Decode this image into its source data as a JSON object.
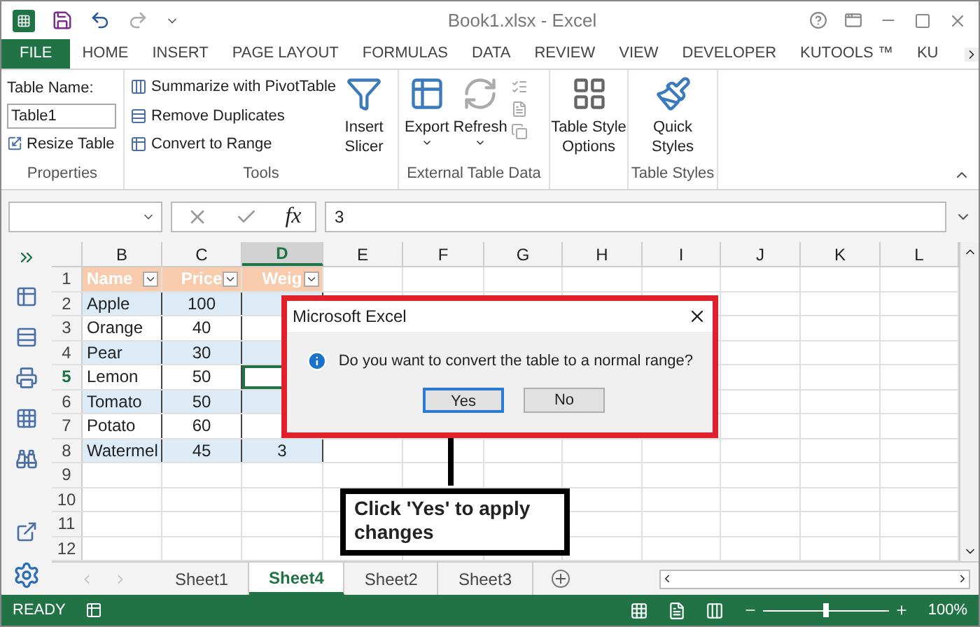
{
  "window": {
    "title": "Book1.xlsx - Excel"
  },
  "tabs": [
    {
      "label": "FILE",
      "kind": "file"
    },
    {
      "label": "HOME",
      "kind": "tab"
    },
    {
      "label": "INSERT",
      "kind": "tab"
    },
    {
      "label": "PAGE LAYOUT",
      "kind": "tab"
    },
    {
      "label": "FORMULAS",
      "kind": "tab"
    },
    {
      "label": "DATA",
      "kind": "tab"
    },
    {
      "label": "REVIEW",
      "kind": "tab"
    },
    {
      "label": "VIEW",
      "kind": "tab"
    },
    {
      "label": "DEVELOPER",
      "kind": "tab"
    },
    {
      "label": "KUTOOLS ™",
      "kind": "tab"
    },
    {
      "label": "KU",
      "kind": "tab"
    }
  ],
  "ribbon": {
    "properties": {
      "table_name_label": "Table Name:",
      "table_name_value": "Table1",
      "resize": "Resize Table",
      "group": "Properties"
    },
    "tools": {
      "items": [
        "Summarize with PivotTable",
        "Remove Duplicates",
        "Convert to Range"
      ],
      "slicer": [
        "Insert",
        "Slicer"
      ],
      "group": "Tools"
    },
    "external": {
      "export": "Export",
      "refresh": "Refresh",
      "group": "External Table Data"
    },
    "style_options": [
      "Table Style",
      "Options"
    ],
    "quick_styles": [
      "Quick",
      "Styles"
    ],
    "table_styles_group": "Table Styles"
  },
  "formula_bar": {
    "fx_label": "fx",
    "value": "3"
  },
  "grid": {
    "columns": [
      {
        "label": "B",
        "selected": false
      },
      {
        "label": "C",
        "selected": false
      },
      {
        "label": "D",
        "selected": true
      },
      {
        "label": "E",
        "selected": false
      },
      {
        "label": "F",
        "selected": false
      },
      {
        "label": "G",
        "selected": false
      },
      {
        "label": "H",
        "selected": false
      },
      {
        "label": "I",
        "selected": false
      },
      {
        "label": "J",
        "selected": false
      },
      {
        "label": "K",
        "selected": false
      },
      {
        "label": "L",
        "selected": false
      }
    ],
    "rows": [
      {
        "label": "1",
        "selected": false,
        "kind": "header",
        "cells": [
          "Name",
          "Price",
          "Weig"
        ]
      },
      {
        "label": "2",
        "selected": false,
        "kind": "data",
        "cells": [
          "Apple",
          "100"
        ]
      },
      {
        "label": "3",
        "selected": false,
        "kind": "data",
        "cells": [
          "Orange",
          "40"
        ]
      },
      {
        "label": "4",
        "selected": false,
        "kind": "data",
        "cells": [
          "Pear",
          "30"
        ]
      },
      {
        "label": "5",
        "selected": true,
        "kind": "data",
        "cells": [
          "Lemon",
          "50"
        ]
      },
      {
        "label": "6",
        "selected": false,
        "kind": "data",
        "cells": [
          "Tomato",
          "50"
        ]
      },
      {
        "label": "7",
        "selected": false,
        "kind": "data",
        "cells": [
          "Potato",
          "60"
        ]
      },
      {
        "label": "8",
        "selected": false,
        "kind": "data",
        "cells": [
          "Watermel",
          "45",
          "3"
        ]
      },
      {
        "label": "9",
        "selected": false,
        "kind": "empty",
        "cells": []
      },
      {
        "label": "10",
        "selected": false,
        "kind": "empty",
        "cells": []
      },
      {
        "label": "11",
        "selected": false,
        "kind": "empty",
        "cells": []
      },
      {
        "label": "12",
        "selected": false,
        "kind": "empty",
        "cells": []
      }
    ]
  },
  "dialog": {
    "title": "Microsoft Excel",
    "message": "Do you want to convert the table to a normal range?",
    "buttons": [
      {
        "label": "Yes",
        "selected": true
      },
      {
        "label": "No",
        "selected": false
      }
    ]
  },
  "callout": {
    "text": "Click 'Yes' to apply changes"
  },
  "sheets": [
    {
      "label": "Sheet1",
      "selected": false
    },
    {
      "label": "Sheet4",
      "selected": true
    },
    {
      "label": "Sheet2",
      "selected": false
    },
    {
      "label": "Sheet3",
      "selected": false
    }
  ],
  "status_bar": {
    "status": "READY",
    "zoom": "100%",
    "level": 0.5
  }
}
